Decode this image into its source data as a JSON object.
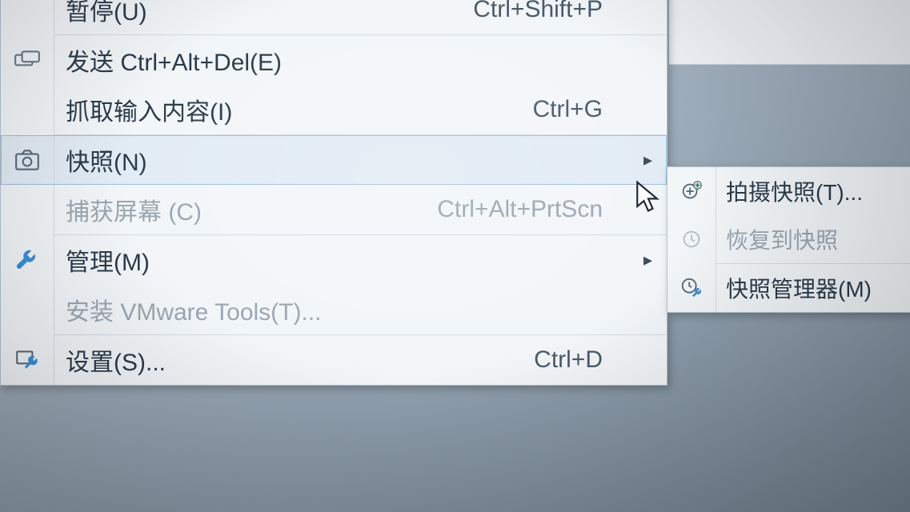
{
  "main_menu": {
    "items": [
      {
        "id": "pause",
        "label": "暂停(U)",
        "accel": "Ctrl+Shift+P",
        "enabled": true,
        "icon": "",
        "submenu": false
      },
      {
        "id": "send_cad",
        "label": "发送 Ctrl+Alt+Del(E)",
        "accel": "",
        "enabled": true,
        "icon": "send-cad",
        "submenu": false,
        "sep_before": true
      },
      {
        "id": "grab_input",
        "label": "抓取输入内容(I)",
        "accel": "Ctrl+G",
        "enabled": true,
        "icon": "",
        "submenu": false
      },
      {
        "id": "snapshot",
        "label": "快照(N)",
        "accel": "",
        "enabled": true,
        "icon": "snapshot",
        "submenu": true,
        "sep_before": true,
        "highlighted": true
      },
      {
        "id": "capture",
        "label": "捕获屏幕 (C)",
        "accel": "Ctrl+Alt+PrtScn",
        "enabled": false,
        "icon": "",
        "submenu": false
      },
      {
        "id": "manage",
        "label": "管理(M)",
        "accel": "",
        "enabled": true,
        "icon": "wrench",
        "submenu": true,
        "sep_before": true
      },
      {
        "id": "vmtools",
        "label": "安装 VMware Tools(T)...",
        "accel": "",
        "enabled": false,
        "icon": "",
        "submenu": false
      },
      {
        "id": "settings",
        "label": "设置(S)...",
        "accel": "Ctrl+D",
        "enabled": true,
        "icon": "settings",
        "submenu": false,
        "sep_before": true
      }
    ]
  },
  "sub_menu": {
    "items": [
      {
        "id": "take_snapshot",
        "label": "拍摄快照(T)...",
        "enabled": true,
        "icon": "camera-plus"
      },
      {
        "id": "revert_snapshot",
        "label": "恢复到快照",
        "enabled": false,
        "icon": "clock"
      },
      {
        "id": "snapshot_manager",
        "label": "快照管理器(M)",
        "enabled": true,
        "icon": "clock-wrench",
        "sep_before": true
      }
    ]
  },
  "submenu_arrow": "▸"
}
